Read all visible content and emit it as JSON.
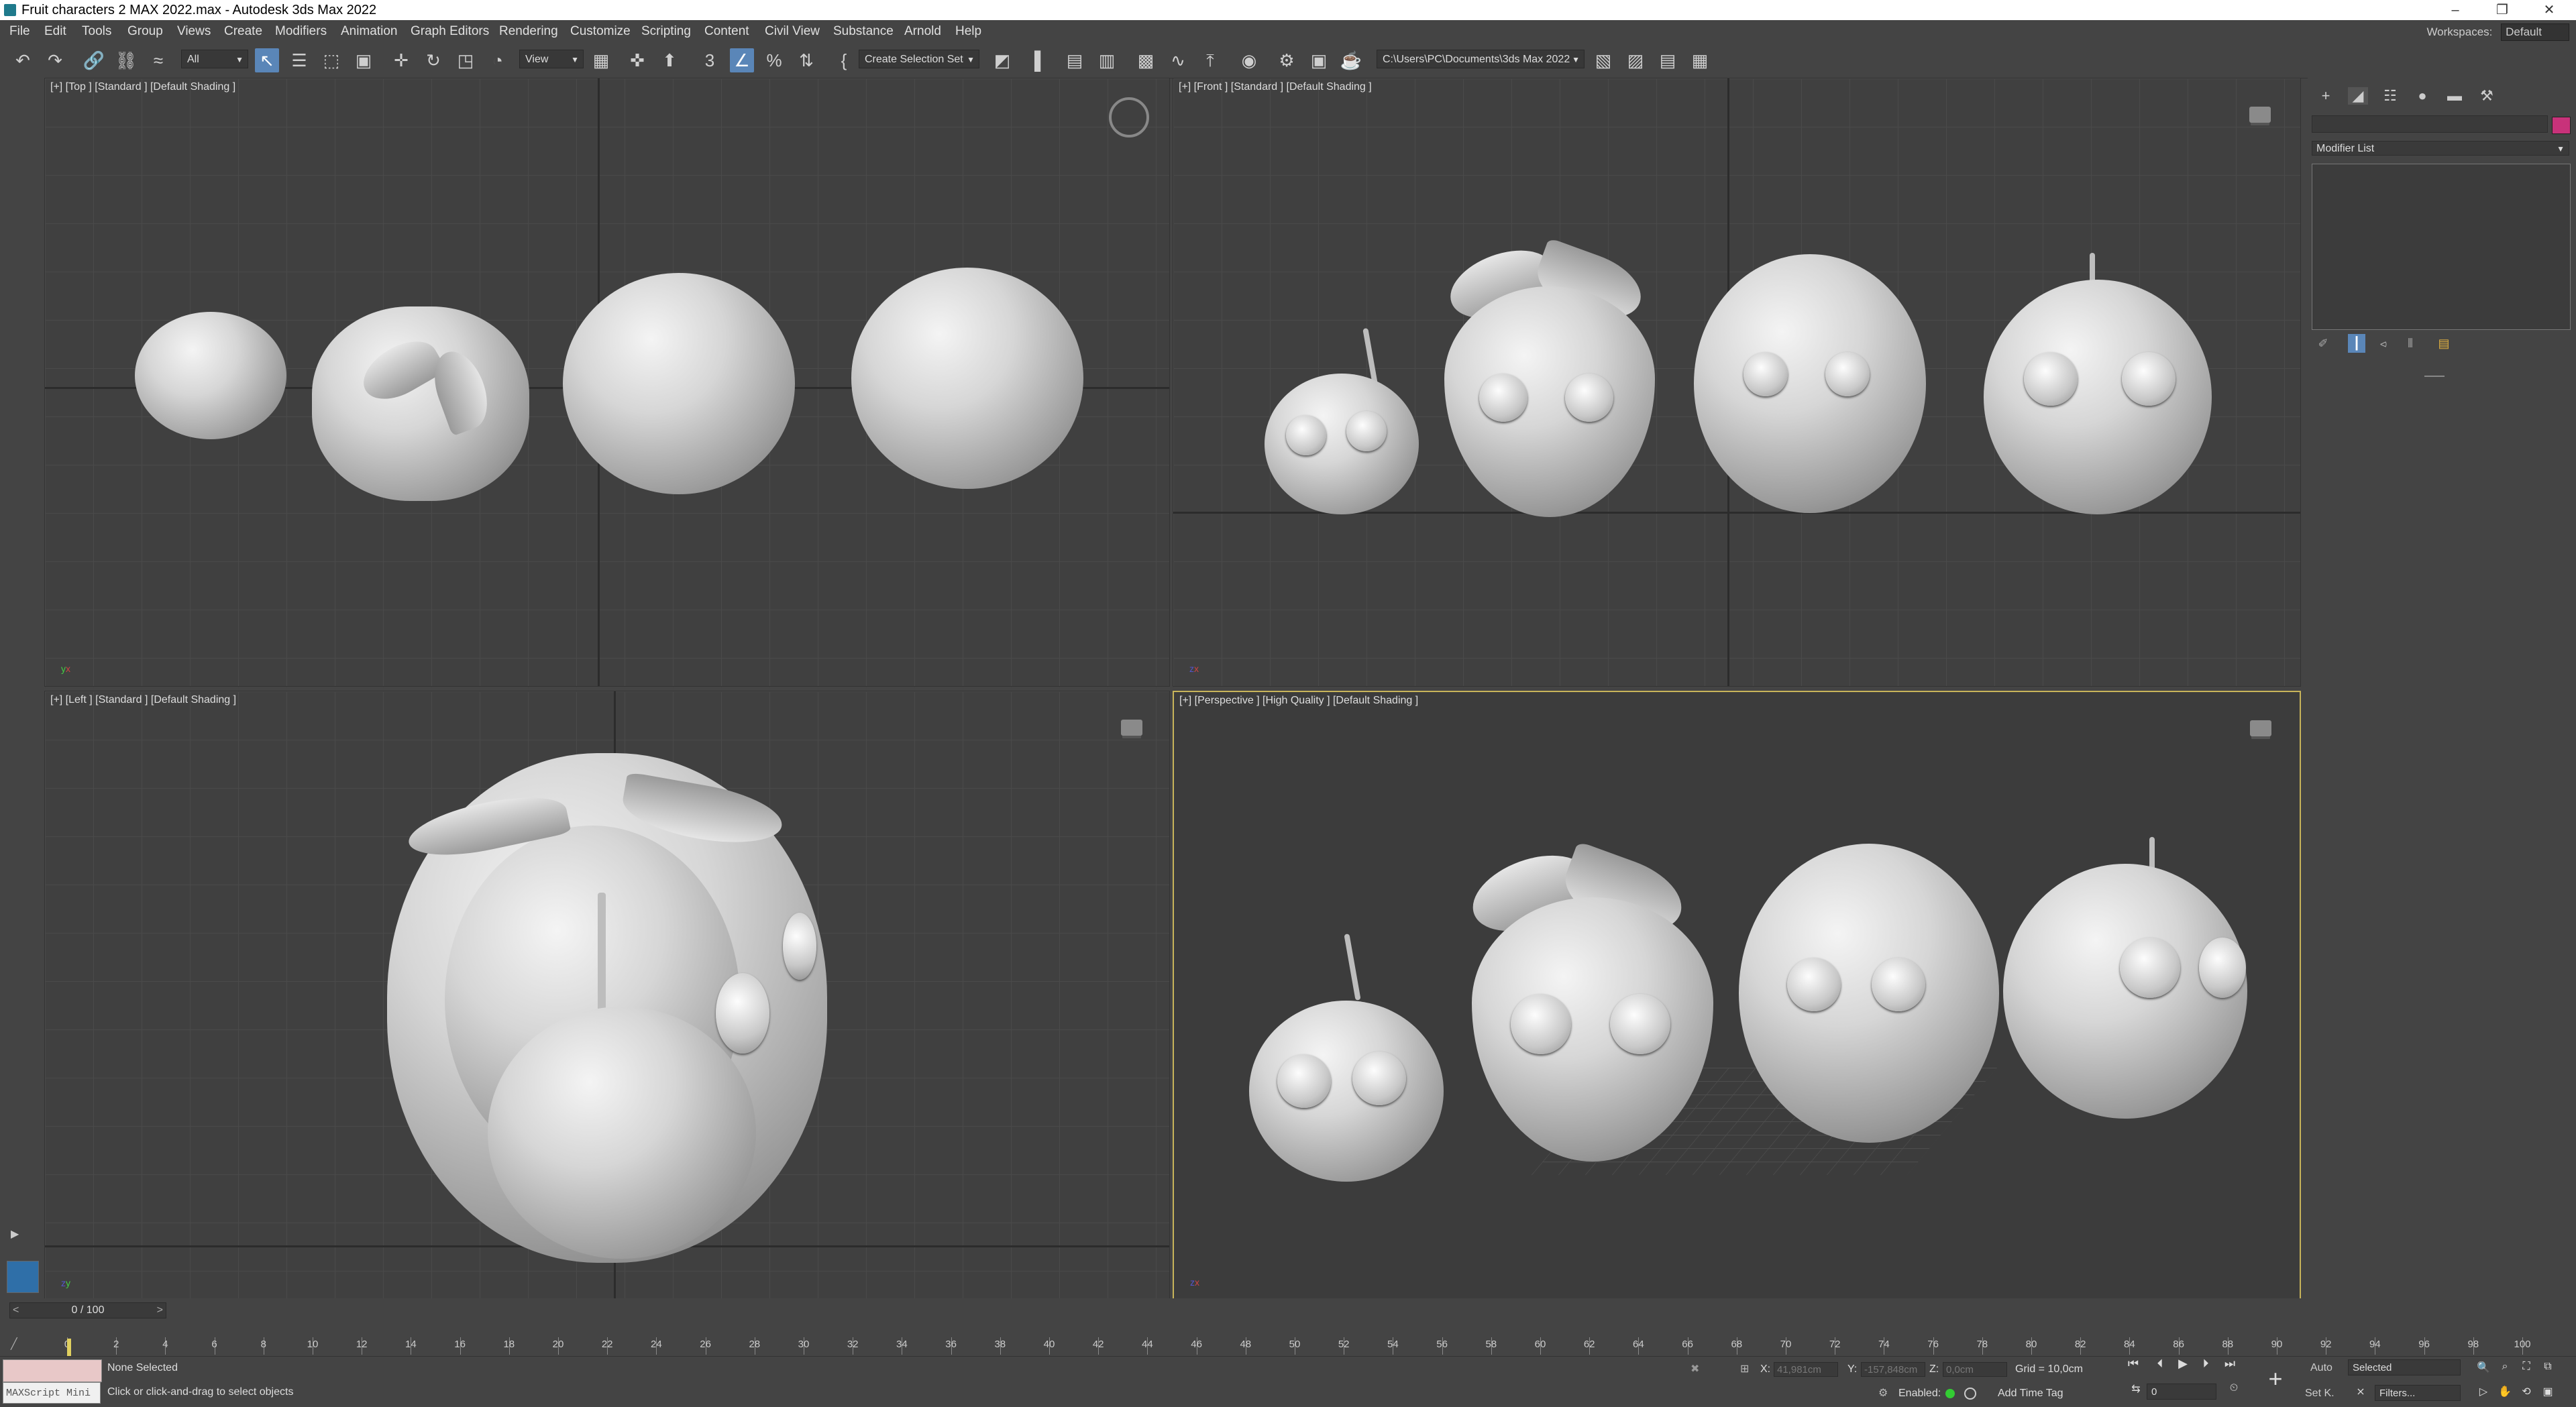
{
  "window": {
    "title": "Fruit characters 2 MAX 2022.max - Autodesk 3ds Max 2022",
    "minimize": "–",
    "restore": "❐",
    "close": "✕"
  },
  "menu": {
    "items": [
      "File",
      "Edit",
      "Tools",
      "Group",
      "Views",
      "Create",
      "Modifiers",
      "Animation",
      "Graph Editors",
      "Rendering",
      "Customize",
      "Scripting",
      "Content",
      "Civil View",
      "Substance",
      "Arnold",
      "Help"
    ],
    "workspaces_label": "Workspaces:",
    "workspaces_value": "Default"
  },
  "toolbar": {
    "filter_value": "All",
    "refcoord_value": "View",
    "selection_set": "Create Selection Set",
    "project_path": "C:\\Users\\PC\\Documents\\3ds Max 2022"
  },
  "viewports": {
    "top": {
      "label": "[+] [Top ] [Standard ] [Default Shading ]"
    },
    "front": {
      "label": "[+] [Front ] [Standard ] [Default Shading ]"
    },
    "left": {
      "label": "[+] [Left ] [Standard ] [Default Shading ]"
    },
    "perspective": {
      "label": "[+] [Perspective ] [High Quality ] [Default Shading ]"
    }
  },
  "command_panel": {
    "modifier_list": "Modifier List"
  },
  "timeline": {
    "slider": "0 / 100",
    "ruler": [
      "0",
      "2",
      "4",
      "6",
      "8",
      "10",
      "12",
      "14",
      "16",
      "18",
      "20",
      "22",
      "24",
      "26",
      "28",
      "30",
      "32",
      "34",
      "36",
      "38",
      "40",
      "42",
      "44",
      "46",
      "48",
      "50",
      "52",
      "54",
      "56",
      "58",
      "60",
      "62",
      "64",
      "66",
      "68",
      "70",
      "72",
      "74",
      "76",
      "78",
      "80",
      "82",
      "84",
      "86",
      "88",
      "90",
      "92",
      "94",
      "96",
      "98",
      "100"
    ]
  },
  "status": {
    "maxscript": "MAXScript Mini",
    "selection": "None Selected",
    "prompt": "Click or click-and-drag to select objects",
    "x_label": "X:",
    "x_value": "41,981cm",
    "y_label": "Y:",
    "y_value": "-157,848cm",
    "z_label": "Z:",
    "z_value": "0,0cm",
    "grid": "Grid = 10,0cm",
    "enabled": "Enabled:",
    "add_time_tag": "Add Time Tag",
    "auto": "Auto",
    "selected": "Selected",
    "set_key": "Set K.",
    "filters": "Filters...",
    "frame": "0"
  }
}
